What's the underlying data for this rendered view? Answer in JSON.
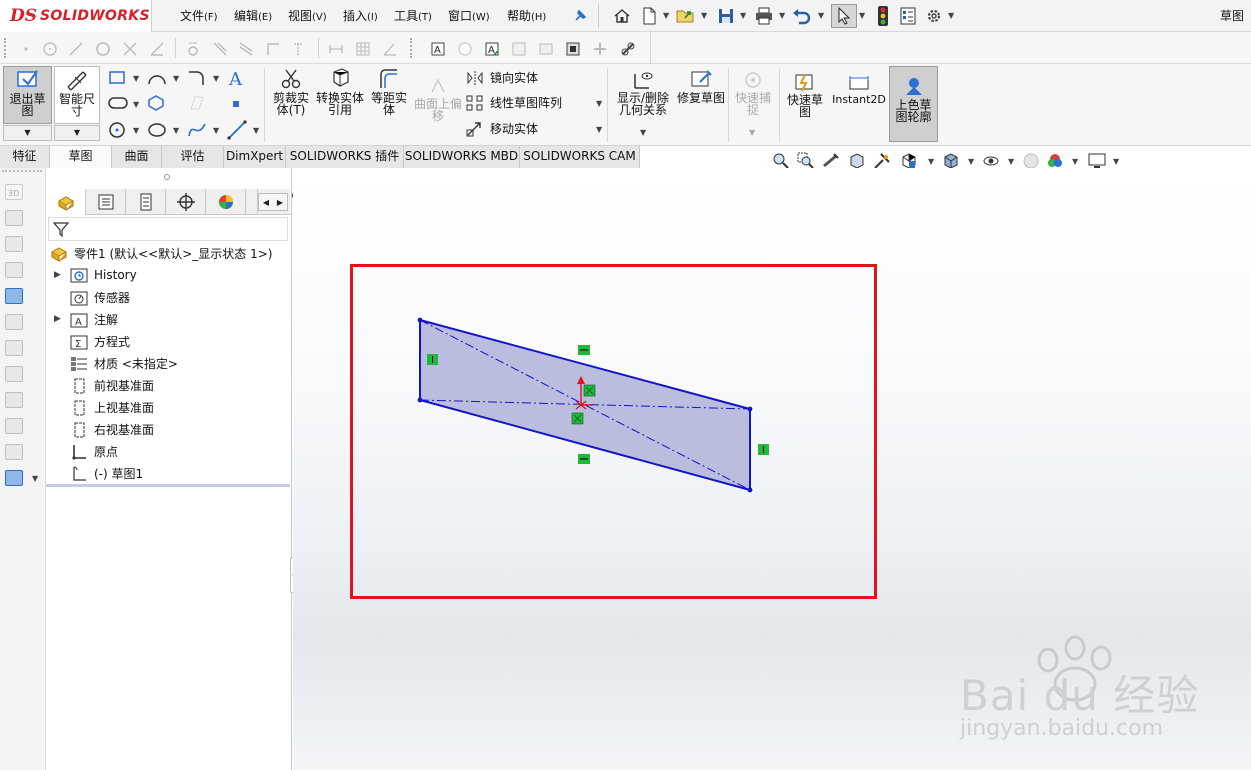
{
  "app": {
    "brand_ds": "DS",
    "brand_name": "SOLIDWORKS",
    "window_title_right": "草图"
  },
  "menu": {
    "items": [
      {
        "label": "文件",
        "key": "(F)"
      },
      {
        "label": "编辑",
        "key": "(E)"
      },
      {
        "label": "视图",
        "key": "(V)"
      },
      {
        "label": "插入",
        "key": "(I)"
      },
      {
        "label": "工具",
        "key": "(T)"
      },
      {
        "label": "窗口",
        "key": "(W)"
      },
      {
        "label": "帮助",
        "key": "(H)"
      }
    ]
  },
  "command_manager": {
    "exit_sketch": "退出草图",
    "smart_dimension": "智能尺寸",
    "trim": "剪裁实体(T)",
    "convert": "转换实体引用",
    "offset": "等距实体",
    "surface_offset": "曲面上偏移",
    "mirror": "镜向实体",
    "linear_pattern": "线性草图阵列",
    "move": "移动实体",
    "display_relations": "显示/删除几何关系",
    "repair": "修复草图",
    "quick_snaps": "快速捕捉",
    "rapid_sketch": "快速草图",
    "instant2d": "Instant2D",
    "shaded_contours": "上色草图轮廓"
  },
  "tabs": [
    "特征",
    "草图",
    "曲面",
    "评估",
    "DimXpert",
    "SOLIDWORKS 插件",
    "SOLIDWORKS MBD",
    "SOLIDWORKS CAM"
  ],
  "active_tab": "草图",
  "feature_tree": {
    "root": "零件1  (默认<<默认>_显示状态 1>)",
    "items": [
      {
        "label": "History",
        "expandable": true
      },
      {
        "label": "传感器",
        "expandable": false
      },
      {
        "label": "注解",
        "expandable": true
      },
      {
        "label": "方程式",
        "expandable": false
      },
      {
        "label": "材质 <未指定>",
        "expandable": false
      },
      {
        "label": "前视基准面",
        "expandable": false
      },
      {
        "label": "上视基准面",
        "expandable": false
      },
      {
        "label": "右视基准面",
        "expandable": false
      },
      {
        "label": "原点",
        "expandable": false
      },
      {
        "label": "(-) 草图1",
        "expandable": false
      }
    ]
  },
  "sketch": {
    "shape": "parallelogram",
    "fill": "#b6b9dc",
    "edge_color": "#1414c8",
    "relation_color": "#1fb83a",
    "highlight_color": "#e0151b"
  },
  "watermark": {
    "brand": "Bai du 经验",
    "url": "jingyan.baidu.com"
  }
}
